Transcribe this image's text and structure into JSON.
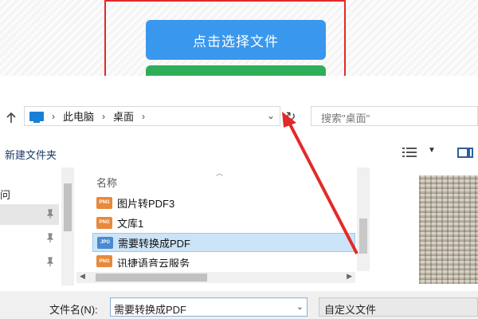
{
  "web": {
    "choose_file_button": "点击选择文件"
  },
  "dialog": {
    "breadcrumb": [
      "此电脑",
      "桌面"
    ],
    "breadcrumb_sep": "›",
    "search_placeholder": "搜索\"桌面\"",
    "toolbar": {
      "new_folder": "新建文件夹"
    },
    "nav_pane": {
      "partial_label": "问"
    },
    "file_list": {
      "column_name": "名称",
      "items": [
        {
          "type": "PNG",
          "name": "图片转PDF3",
          "selected": false
        },
        {
          "type": "PNG",
          "name": "文库1",
          "selected": false
        },
        {
          "type": "JPG",
          "name": "需要转换成PDF",
          "selected": true
        },
        {
          "type": "PNG",
          "name": "讯捷语音云服务",
          "selected": false
        }
      ]
    },
    "file_name_label": "文件名(N):",
    "file_name_value": "需要转换成PDF",
    "file_type_value": "自定义文件"
  },
  "colors": {
    "primary_button": "#3a97ee",
    "secondary_button": "#2fae5a",
    "annotation": "#e22a2a",
    "selection": "#cce4f7"
  },
  "icons": [
    "up-arrow-icon",
    "computer-icon",
    "chevron-down-icon",
    "refresh-icon",
    "view-options-icon",
    "preview-pane-icon",
    "pin-icon",
    "png-file-icon",
    "jpg-file-icon",
    "sort-up-icon"
  ]
}
